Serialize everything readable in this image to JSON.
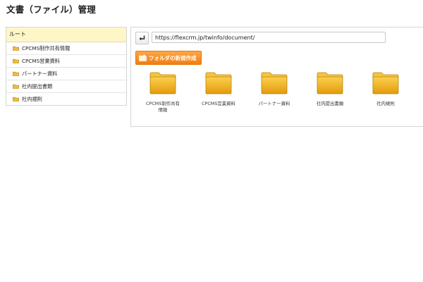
{
  "page": {
    "title": "文書（ファイル）管理"
  },
  "sidebar": {
    "root_label": "ルート",
    "items": [
      {
        "label": "CPCMS制作共有情報",
        "icon": "folder-icon"
      },
      {
        "label": "CPCMS営業資料",
        "icon": "folder-icon"
      },
      {
        "label": "パートナー資料",
        "icon": "folder-icon"
      },
      {
        "label": "社内提出書類",
        "icon": "folder-icon"
      },
      {
        "label": "社内規則",
        "icon": "folder-icon"
      }
    ]
  },
  "toolbar": {
    "up_icon": "return-arrow-icon",
    "path_value": "https://flexcrm.jp/twinfo/document/",
    "new_folder_label": "フォルダの新規作成",
    "new_folder_icon": "add-folder-icon"
  },
  "folders": [
    {
      "label": "CPCMS制作共有情報"
    },
    {
      "label": "CPCMS営業資料"
    },
    {
      "label": "パートナー資料"
    },
    {
      "label": "社内提出書類"
    },
    {
      "label": "社内規則"
    }
  ],
  "colors": {
    "root_highlight": "#fff6c8",
    "accent_orange": "#f5891f",
    "folder_yellow": "#f2b21d"
  }
}
